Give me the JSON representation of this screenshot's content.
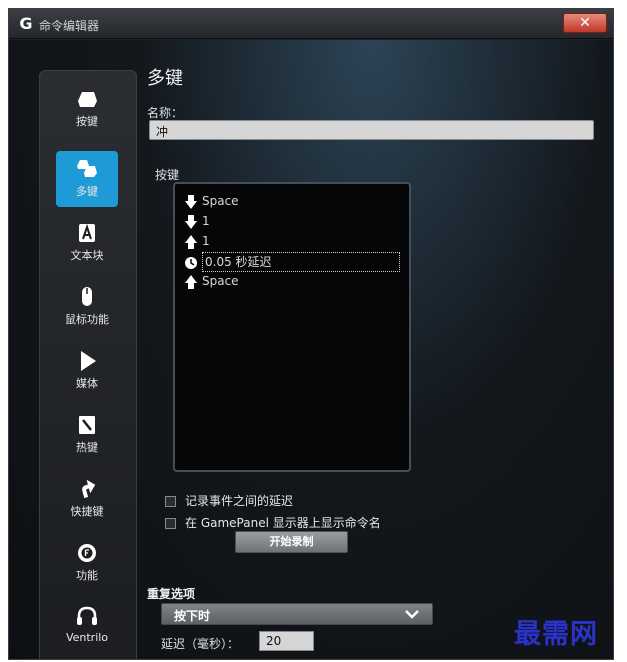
{
  "window": {
    "title": "命令编辑器",
    "close": "✕"
  },
  "sidebar": {
    "items": [
      {
        "label": "按键",
        "icon": "key-icon"
      },
      {
        "label": "多键",
        "icon": "multi-key-icon",
        "active": true
      },
      {
        "label": "文本块",
        "icon": "text-block-icon"
      },
      {
        "label": "鼠标功能",
        "icon": "mouse-icon"
      },
      {
        "label": "媒体",
        "icon": "media-play-icon"
      },
      {
        "label": "热键",
        "icon": "hotkey-icon"
      },
      {
        "label": "快捷键",
        "icon": "shortcut-arrow-icon"
      },
      {
        "label": "功能",
        "icon": "function-icon"
      },
      {
        "label": "Ventrilo",
        "icon": "headset-icon"
      }
    ]
  },
  "main": {
    "title": "多键",
    "name_label": "名称：",
    "name_value": "冲",
    "keys_label": "按键",
    "key_events": [
      {
        "type": "down",
        "value": "Space"
      },
      {
        "type": "down",
        "value": "1"
      },
      {
        "type": "up",
        "value": "1"
      },
      {
        "type": "delay",
        "value": "0.05 秒延迟"
      },
      {
        "type": "up",
        "value": "Space"
      }
    ],
    "record_delays_label": "记录事件之间的延迟",
    "show_name_label": "在 GamePanel 显示器上显示命令名",
    "record_button": "开始录制",
    "repeat_label": "重复选项",
    "repeat_value": "按下时",
    "delay_label": "延迟（毫秒）：",
    "delay_value": "20"
  },
  "watermark": "最需网"
}
